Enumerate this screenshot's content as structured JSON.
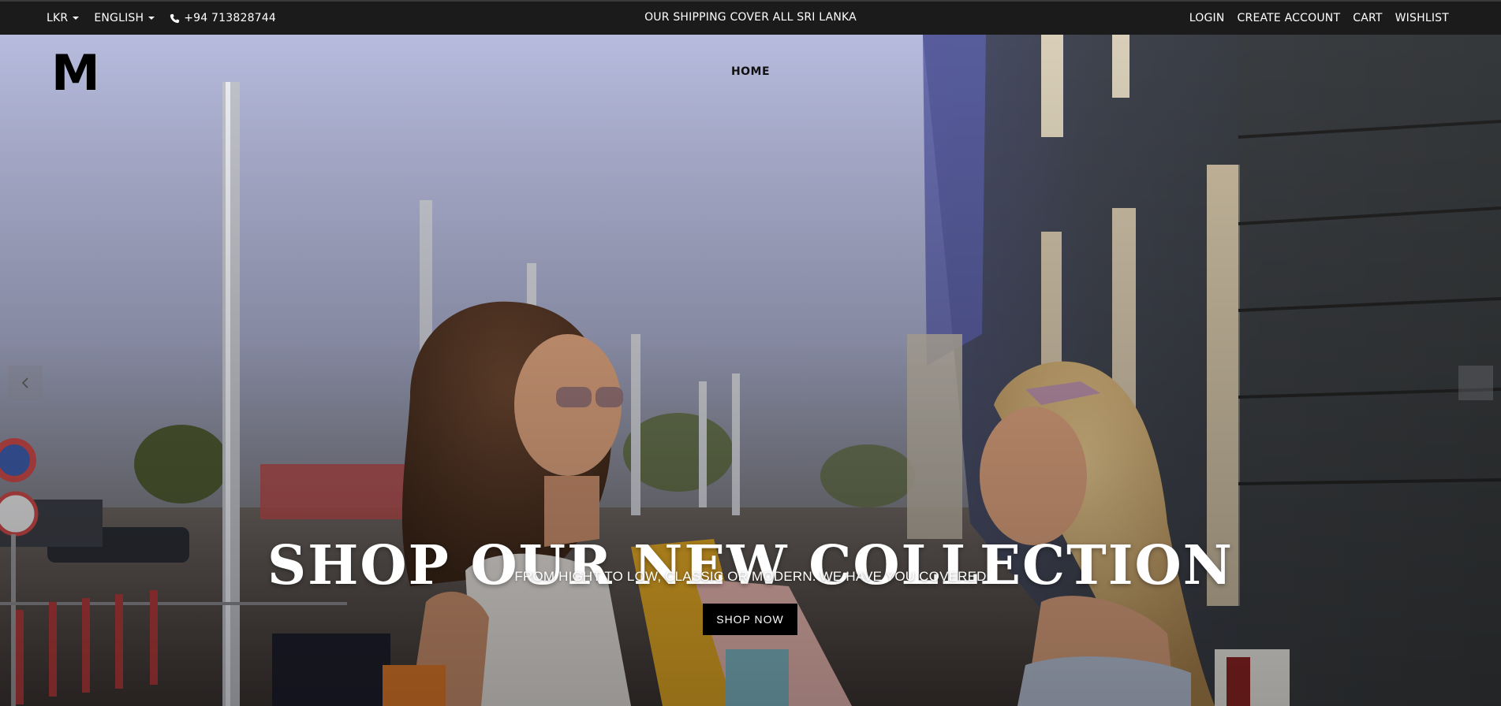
{
  "topbar": {
    "currency": "LKR",
    "language": "ENGLISH",
    "phone": "+94 713828744",
    "announcement": "OUR SHIPPING COVER ALL SRI LANKA",
    "links": [
      "LOGIN",
      "CREATE ACCOUNT",
      "CART",
      "WISHLIST"
    ]
  },
  "header": {
    "logo_text": "M",
    "nav": [
      "HOME"
    ]
  },
  "hero": {
    "headline": "SHOP OUR NEW COLLECTION",
    "subheadline": "FROM HIGHT TO LOW, CLASSIC OR MODERN. WE HAVE YOU COVERED",
    "cta": "SHOP NOW",
    "prev_icon": "chevron-left-icon",
    "next_icon": "chevron-right-icon"
  },
  "colors": {
    "topbar_bg": "#1b1b1b",
    "button_bg": "#000000",
    "text_light": "#ffffff"
  }
}
